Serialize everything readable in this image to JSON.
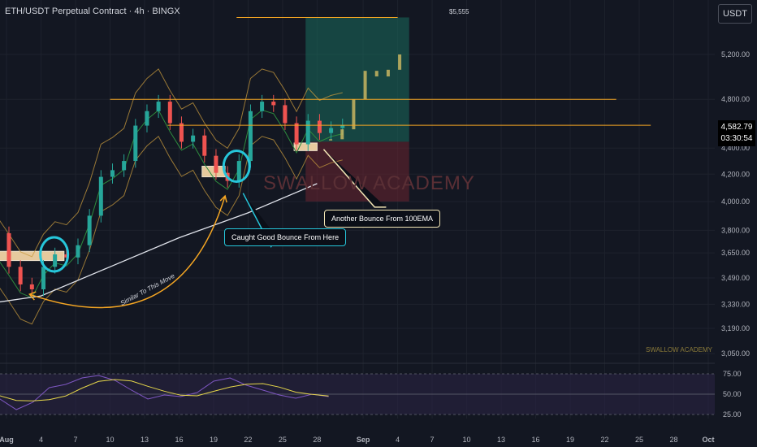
{
  "header": {
    "title": "ETH/USDT Perpetual Contract · 4h · BINGX",
    "currency_button": "USDT"
  },
  "price_tag": {
    "price": "4,582.79",
    "countdown": "03:30:54"
  },
  "annotations": {
    "target_label": "$5,555",
    "callout_bounce": "Caught Good Bounce From Here",
    "callout_ema": "Another Bounce From 100EMA",
    "arrow_label": "Similar To This Move",
    "watermark_main": "SWALLOW ACADEMY",
    "watermark_small": "SWALLOW ACADEMY"
  },
  "colors": {
    "background": "#131722",
    "up_candle": "#26a69a",
    "down_candle": "#ef5350",
    "callout_blue": "#26c6da",
    "orange": "#f5a623",
    "ema_white": "#e0e3eb",
    "rsi_line": "#7e57c2"
  },
  "chart_data": {
    "type": "candlestick",
    "symbol": "ETH/USDT Perpetual Contract",
    "timeframe": "4h",
    "exchange": "BINGX",
    "x_ticks": [
      "Aug",
      "4",
      "7",
      "10",
      "13",
      "16",
      "19",
      "22",
      "25",
      "28",
      "Sep",
      "4",
      "7",
      "10",
      "13",
      "16",
      "19",
      "22",
      "25",
      "28",
      "Oct"
    ],
    "y_ticks": [
      "5,200.00",
      "4,800.00",
      "4,400.00",
      "4,200.00",
      "4,000.00",
      "3,800.00",
      "3,650.00",
      "3,490.00",
      "3,330.00",
      "3,190.00",
      "3,050.00"
    ],
    "y_scale": "log",
    "last_price": 4582.79,
    "horizontal_levels": [
      4800,
      4582.79
    ],
    "target_level": 5555,
    "long_position": {
      "entry": 4450,
      "target": 5555,
      "stop": 4000
    },
    "support_zones": [
      {
        "date_start": "Jul 30",
        "date_end": "Aug 6",
        "price_low": 3600,
        "price_high": 3660
      },
      {
        "date_start": "Aug 18",
        "date_end": "Aug 20",
        "price_low": 4180,
        "price_high": 4260
      },
      {
        "date_start": "Aug 26",
        "date_end": "Aug 28",
        "price_low": 4380,
        "price_high": 4440
      }
    ],
    "close_path": [
      {
        "date": "Jul 30",
        "close": 3780
      },
      {
        "date": "Aug 1",
        "close": 3560
      },
      {
        "date": "Aug 2",
        "close": 3450
      },
      {
        "date": "Aug 3",
        "close": 3420
      },
      {
        "date": "Aug 4",
        "close": 3560
      },
      {
        "date": "Aug 5",
        "close": 3640
      },
      {
        "date": "Aug 6",
        "close": 3620
      },
      {
        "date": "Aug 7",
        "close": 3700
      },
      {
        "date": "Aug 8",
        "close": 3900
      },
      {
        "date": "Aug 9",
        "close": 4180
      },
      {
        "date": "Aug 10",
        "close": 4230
      },
      {
        "date": "Aug 11",
        "close": 4300
      },
      {
        "date": "Aug 12",
        "close": 4580
      },
      {
        "date": "Aug 13",
        "close": 4700
      },
      {
        "date": "Aug 14",
        "close": 4780
      },
      {
        "date": "Aug 15",
        "close": 4600
      },
      {
        "date": "Aug 16",
        "close": 4450
      },
      {
        "date": "Aug 17",
        "close": 4500
      },
      {
        "date": "Aug 18",
        "close": 4340
      },
      {
        "date": "Aug 19",
        "close": 4210
      },
      {
        "date": "Aug 20",
        "close": 4150
      },
      {
        "date": "Aug 21",
        "close": 4300
      },
      {
        "date": "Aug 22",
        "close": 4700
      },
      {
        "date": "Aug 23",
        "close": 4780
      },
      {
        "date": "Aug 24",
        "close": 4750
      },
      {
        "date": "Aug 25",
        "close": 4600
      },
      {
        "date": "Aug 26",
        "close": 4430
      },
      {
        "date": "Aug 27",
        "close": 4620
      },
      {
        "date": "Aug 28",
        "close": 4520
      },
      {
        "date": "Aug 29",
        "close": 4560
      },
      {
        "date": "Aug 30",
        "close": 4582.79
      }
    ],
    "projection": [
      {
        "date": "Aug 29",
        "price": 4470
      },
      {
        "date": "Aug 30",
        "price": 4550
      },
      {
        "date": "Aug 31",
        "price": 4800
      },
      {
        "date": "Sep 1",
        "price": 5050
      },
      {
        "date": "Sep 2",
        "price": 5000
      },
      {
        "date": "Sep 3",
        "price": 5060
      },
      {
        "date": "Sep 4",
        "price": 5200
      }
    ],
    "ema_100": [
      {
        "date": "Jul 30",
        "value": 3330
      },
      {
        "date": "Aug 4",
        "value": 3380
      },
      {
        "date": "Aug 10",
        "value": 3560
      },
      {
        "date": "Aug 16",
        "value": 3750
      },
      {
        "date": "Aug 22",
        "value": 3920
      },
      {
        "date": "Aug 28",
        "value": 4130
      }
    ],
    "rsi": {
      "levels": [
        75,
        50,
        25
      ],
      "y_ticks": [
        "75.00",
        "50.00",
        "25.00"
      ],
      "values": [
        52,
        44,
        31,
        40,
        58,
        62,
        70,
        73,
        67,
        55,
        44,
        49,
        47,
        52,
        66,
        70,
        61,
        55,
        49,
        45,
        50,
        47
      ]
    }
  }
}
